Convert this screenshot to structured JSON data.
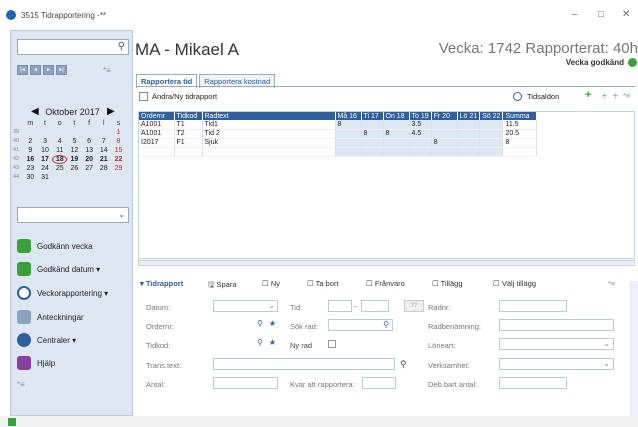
{
  "window": {
    "title": "3515 Tidrapportering -**",
    "minimize": "–",
    "maximize": "□",
    "close": "✕"
  },
  "sidebar": {
    "month_label": "Oktober 2017",
    "weekday_headers": [
      "m",
      "t",
      "o",
      "t",
      "f",
      "l",
      "s"
    ],
    "weeks": [
      {
        "wk": "39",
        "days": [
          "",
          "",
          "",
          "",
          "",
          "",
          "1"
        ]
      },
      {
        "wk": "40",
        "days": [
          "2",
          "3",
          "4",
          "5",
          "6",
          "7",
          "8"
        ]
      },
      {
        "wk": "41",
        "days": [
          "9",
          "10",
          "11",
          "12",
          "13",
          "14",
          "15"
        ]
      },
      {
        "wk": "42",
        "days": [
          "16",
          "17",
          "18",
          "19",
          "20",
          "21",
          "22"
        ]
      },
      {
        "wk": "43",
        "days": [
          "23",
          "24",
          "25",
          "26",
          "27",
          "28",
          "29"
        ]
      },
      {
        "wk": "44",
        "days": [
          "30",
          "31",
          "",
          "",
          "",
          "",
          ""
        ]
      }
    ],
    "today": "18",
    "items": [
      {
        "label": "Godkänn vecka",
        "icon": "check-icon"
      },
      {
        "label": "Godkänd datum ▾",
        "icon": "check-icon"
      },
      {
        "label": "Veckorapportering ▾",
        "icon": "clock-icon"
      },
      {
        "label": "Anteckningar",
        "icon": "notes-icon"
      },
      {
        "label": "Centraler ▾",
        "icon": "centraler-icon"
      },
      {
        "label": "Hjälp",
        "icon": "help-icon"
      }
    ]
  },
  "header": {
    "person": "MA - Mikael A",
    "week": "Vecka: 1742 Rapporterat: 40h",
    "approved": "Vecka godkänd"
  },
  "tabs": [
    "Rapportera tid",
    "Rapportera kostnad"
  ],
  "toolbar": {
    "edit": "Ändra/Ny tidrapport",
    "balance": "Tidsaldon",
    "add": "+",
    "expand": "÷",
    "collapse": "÷",
    "menu": "*≡"
  },
  "grid": {
    "columns": [
      "Ordernr",
      "Tidkod",
      "Radtext",
      "Må 16",
      "Ti 17",
      "On 18",
      "To 19",
      "Fr 20",
      "Lö 21",
      "Sö 22",
      "Summa"
    ],
    "rows": [
      [
        "A1001",
        "T1",
        "Tid1",
        "8",
        "",
        "",
        "3.5",
        "",
        "",
        "",
        "11.5"
      ],
      [
        "A1001",
        "T2",
        "Tid 2",
        "",
        "8",
        "8",
        "4.5",
        "",
        "",
        "",
        "20.5"
      ],
      [
        "I2017",
        "F1",
        "Sjuk",
        "",
        "",
        "",
        "",
        "8",
        "",
        "",
        "8"
      ],
      [
        "",
        "",
        "",
        "",
        "",
        "",
        "",
        "",
        "",
        "",
        ""
      ]
    ]
  },
  "bottom_toolbar": [
    "Tidrapport",
    "Spara",
    "Ny",
    "Ta bort",
    "Frånvaro",
    "Tillägg",
    "Välj tillägg"
  ],
  "form": {
    "datum": "Datum:",
    "ordernr": "Ordernr:",
    "tidkod": "Tidkod:",
    "transtext": "Trans.text:",
    "antal": "Antal:",
    "tid": "Tid:",
    "sok_rad": "Sök rad:",
    "ny_rad": "Ny rad",
    "kvar": "Kvar att rapportera:",
    "radnr": "Radnr:",
    "radbenamning": "Radbenämning:",
    "loneart": "Löneart:",
    "verksamhet": "Verksamhet:",
    "debart": "Deb.bart antal:",
    "time_btn": "??"
  },
  "colors": {
    "accent": "#2f5f9e",
    "sidebar_bg": "#dce7f2",
    "link": "#2a5f9e",
    "green": "#3aa03a"
  }
}
